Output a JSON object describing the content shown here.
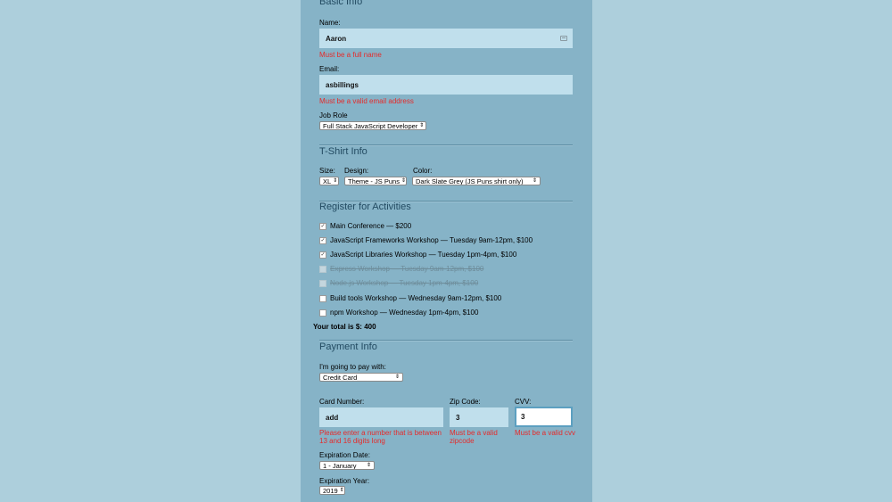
{
  "basic_info": {
    "title": "Basic Info",
    "name_label": "Name:",
    "name_value": "Aaron",
    "name_error": "Must be a full name",
    "email_label": "Email:",
    "email_value": "asbillings",
    "email_error": "Must be a valid email address",
    "job_role_label": "Job Role",
    "job_role_selected": "Full Stack JavaScript Developer"
  },
  "tshirt": {
    "title": "T-Shirt Info",
    "size_label": "Size:",
    "size_selected": "XL",
    "design_label": "Design:",
    "design_selected": "Theme - JS Puns",
    "color_label": "Color:",
    "color_selected": "Dark Slate Grey (JS Puns shirt only)"
  },
  "activities": {
    "title": "Register for Activities",
    "items": [
      {
        "label": "Main Conference — $200",
        "checked": true,
        "disabled": false
      },
      {
        "label": "JavaScript Frameworks Workshop — Tuesday 9am-12pm, $100",
        "checked": true,
        "disabled": false
      },
      {
        "label": "JavaScript Libraries Workshop — Tuesday 1pm-4pm, $100",
        "checked": true,
        "disabled": false
      },
      {
        "label": "Express Workshop — Tuesday 9am-12pm, $100",
        "checked": false,
        "disabled": true
      },
      {
        "label": "Node.js Workshop — Tuesday 1pm-4pm, $100",
        "checked": false,
        "disabled": true
      },
      {
        "label": "Build tools Workshop — Wednesday 9am-12pm, $100",
        "checked": false,
        "disabled": false
      },
      {
        "label": "npm Workshop — Wednesday 1pm-4pm, $100",
        "checked": false,
        "disabled": false
      }
    ],
    "total": "Your total is $: 400"
  },
  "payment": {
    "title": "Payment Info",
    "pay_with_label": "I'm going to pay with:",
    "pay_with_selected": "Credit Card",
    "card_number_label": "Card Number:",
    "card_number_value": "add",
    "card_number_error": "Please enter a number that is between 13 and 16 digits long",
    "zip_label": "Zip Code:",
    "zip_value": "3",
    "zip_error": "Must be a valid zipcode",
    "cvv_label": "CVV:",
    "cvv_value": "3",
    "cvv_error": "Must be a valid cvv",
    "exp_date_label": "Expiration Date:",
    "exp_date_selected": "1 - January",
    "exp_year_label": "Expiration Year:",
    "exp_year_selected": "2019"
  },
  "icons": {
    "select_arrow": "updown-arrows-icon",
    "checkmark": "check-icon",
    "autofill": "contact-card-icon"
  }
}
